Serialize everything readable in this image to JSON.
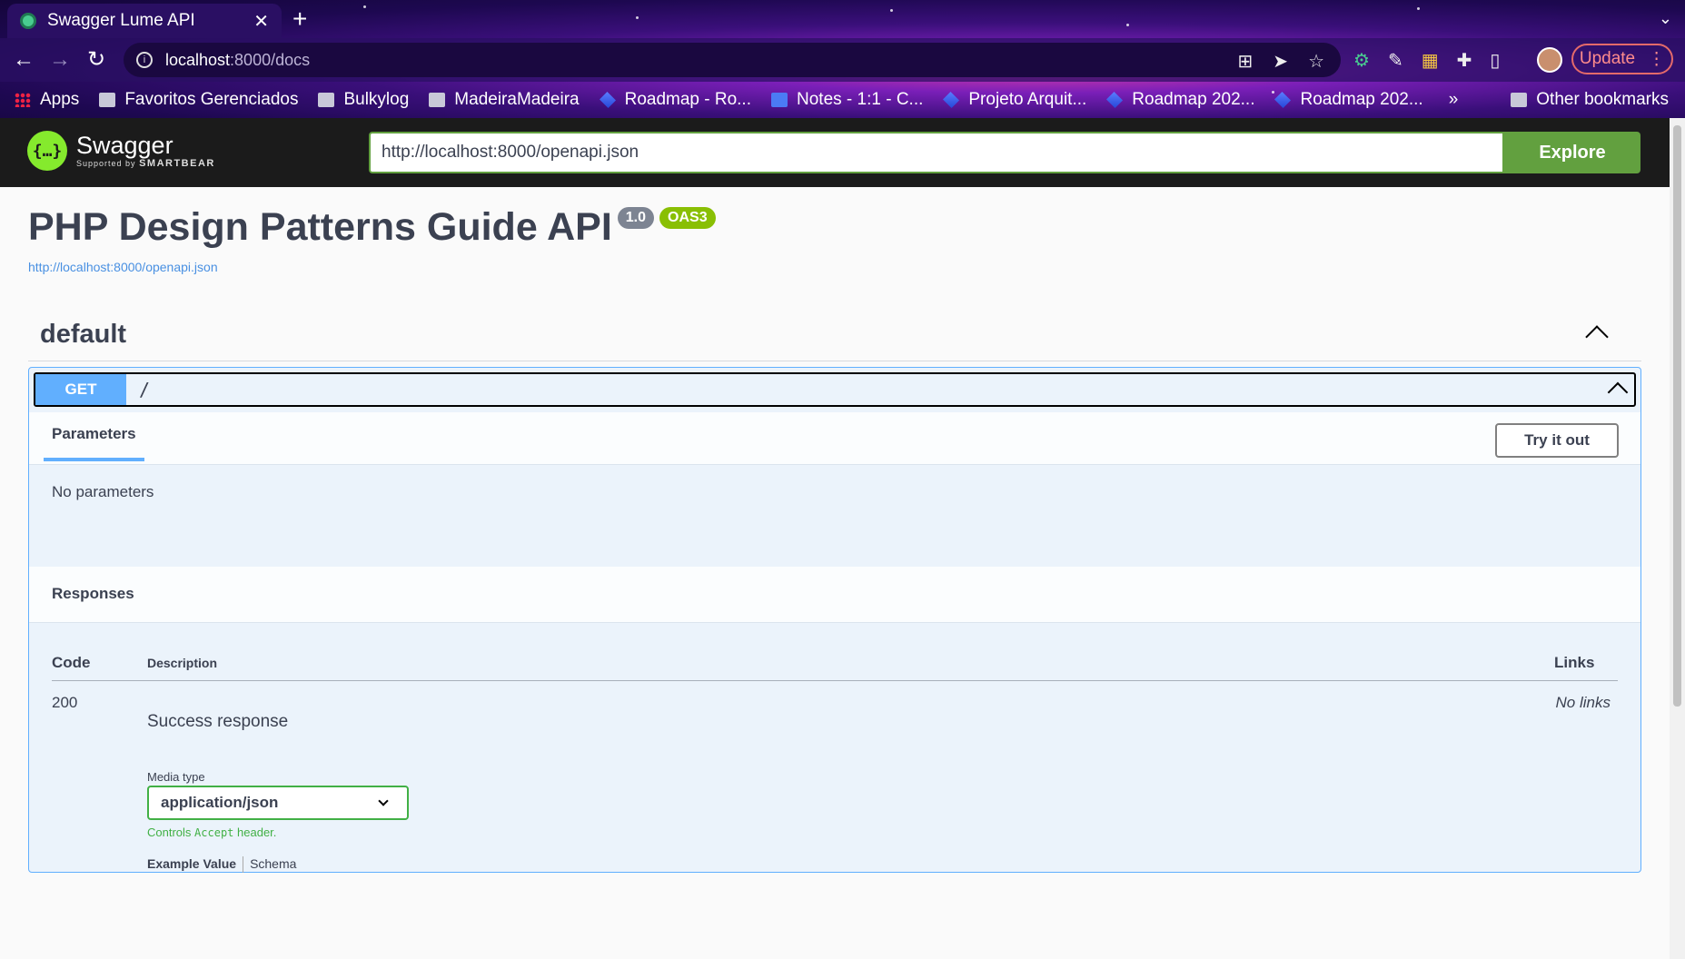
{
  "browser": {
    "tab_title": "Swagger Lume API",
    "url_host": "localhost",
    "url_path": ":8000/docs",
    "update_label": "Update",
    "bookmarks": [
      {
        "label": "Apps",
        "icon": "apps-icon"
      },
      {
        "label": "Favoritos Gerenciados",
        "icon": "folder-icon"
      },
      {
        "label": "Bulkylog",
        "icon": "folder-icon"
      },
      {
        "label": "MadeiraMadeira",
        "icon": "folder-icon"
      },
      {
        "label": "Roadmap - Ro...",
        "icon": "jira-icon"
      },
      {
        "label": "Notes - 1:1 - C...",
        "icon": "doc-icon"
      },
      {
        "label": "Projeto Arquit...",
        "icon": "jira-icon"
      },
      {
        "label": "Roadmap 202...",
        "icon": "jira-icon"
      },
      {
        "label": "Roadmap 202...",
        "icon": "jira-icon"
      }
    ],
    "bookmarks_more": "»",
    "other_bookmarks": "Other bookmarks"
  },
  "swagger": {
    "logo_name": "Swagger",
    "logo_supported": "Supported by",
    "logo_brand": "SMARTBEAR",
    "spec_url": "http://localhost:8000/openapi.json",
    "explore_label": "Explore"
  },
  "info": {
    "title": "PHP Design Patterns Guide API",
    "version": "1.0",
    "oas": "OAS3",
    "link": "http://localhost:8000/openapi.json"
  },
  "section": {
    "name": "default"
  },
  "operation": {
    "method": "GET",
    "path": "/",
    "parameters_tab": "Parameters",
    "try_label": "Try it out",
    "no_params": "No parameters",
    "responses_title": "Responses",
    "columns": {
      "code": "Code",
      "description": "Description",
      "links": "Links"
    },
    "response": {
      "code": "200",
      "description": "Success response",
      "links": "No links",
      "media_type_label": "Media type",
      "media_type_value": "application/json",
      "hint_prefix": "Controls",
      "hint_code": "Accept",
      "hint_suffix": "header.",
      "example_tab": "Example Value",
      "schema_tab": "Schema"
    }
  },
  "colors": {
    "get_method": "#61affe",
    "oas_badge": "#89bf04",
    "explore": "#62a03f"
  }
}
